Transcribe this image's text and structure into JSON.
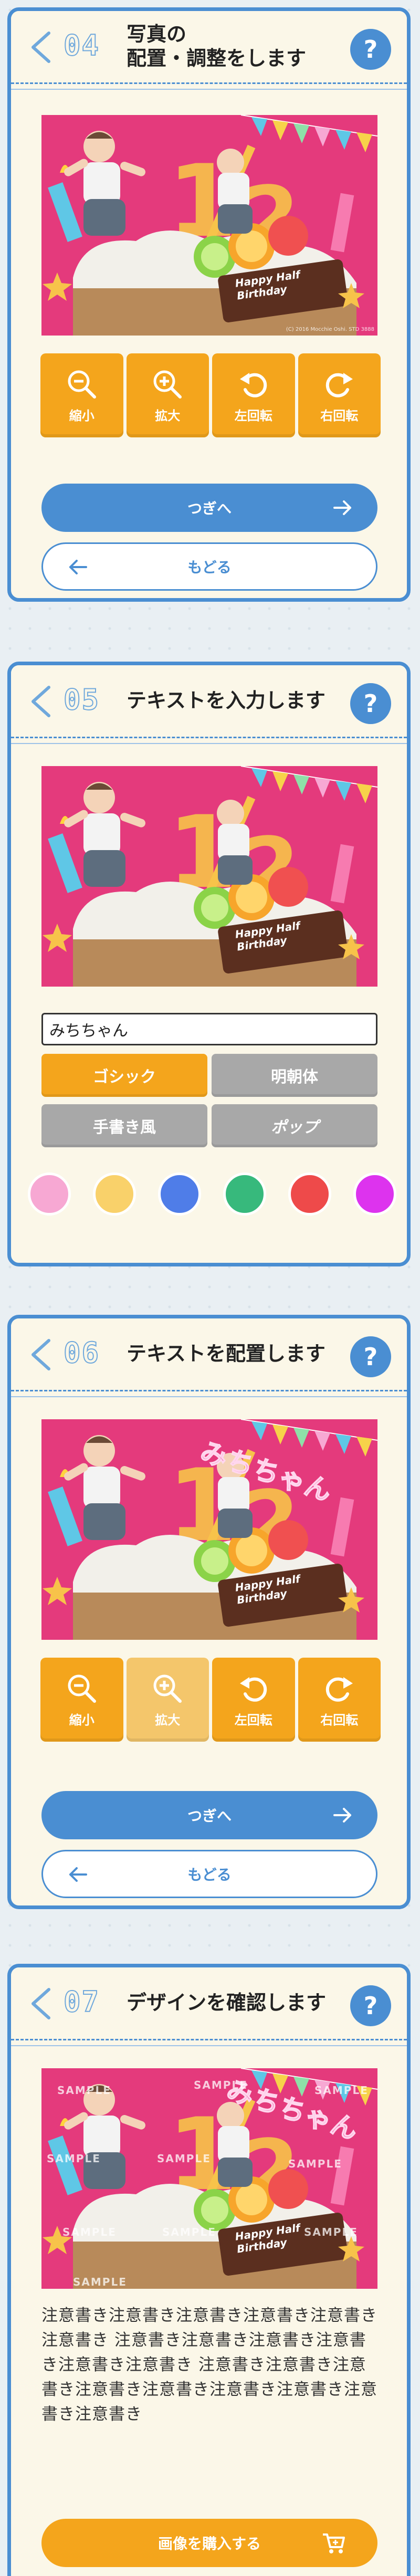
{
  "photo": {
    "number": "1/2",
    "banner_line1": "Happy Half",
    "banner_line2": "Birthday",
    "credit": "(C) 2016 Mocchie Oshi. STD 3888"
  },
  "step4": {
    "number": "04",
    "title_line1": "写真の",
    "title_line2": "配置・調整をします",
    "help": "?",
    "tools": [
      {
        "label": "縮小",
        "icon": "zoom-out-icon"
      },
      {
        "label": "拡大",
        "icon": "zoom-in-icon"
      },
      {
        "label": "左回転",
        "icon": "rotate-left-icon"
      },
      {
        "label": "右回転",
        "icon": "rotate-right-icon"
      }
    ],
    "next_label": "つぎへ",
    "back_label": "もどる"
  },
  "step5": {
    "number": "05",
    "title": "テキストを入力します",
    "help": "?",
    "input_value": "みちちゃん",
    "fonts": [
      "ゴシック",
      "明朝体",
      "手書き風",
      "ポップ"
    ],
    "selected_font": "ゴシック",
    "swatches": [
      "#f7a8d3",
      "#f9d16a",
      "#4f7de8",
      "#37b97c",
      "#ee4a4a",
      "#dd33ee"
    ]
  },
  "step6": {
    "number": "06",
    "title": "テキストを配置します",
    "help": "?",
    "overlay_text": "みちちゃん",
    "tools": [
      {
        "label": "縮小",
        "icon": "zoom-out-icon"
      },
      {
        "label": "拡大",
        "icon": "zoom-in-icon"
      },
      {
        "label": "左回転",
        "icon": "rotate-left-icon"
      },
      {
        "label": "右回転",
        "icon": "rotate-right-icon"
      }
    ],
    "next_label": "つぎへ",
    "back_label": "もどる"
  },
  "step7": {
    "number": "07",
    "title": "デザインを確認します",
    "help": "?",
    "overlay_text": "みちちゃん",
    "watermark": "SAMPLE",
    "notice": "注意書き注意書き注意書き注意書き注意書き注意書き 注意書き注意書き注意書き注意書き注意書き注意書き 注意書き注意書き注意書き注意書き注意書き注意書き注意書き注意書き注意書き",
    "buy_label": "画像を購入する"
  },
  "colors": {
    "accent_blue": "#4a8ed2",
    "accent_orange": "#f4a51c",
    "card_bg": "#fbf7e8",
    "photo_bg": "#e43a7c"
  }
}
